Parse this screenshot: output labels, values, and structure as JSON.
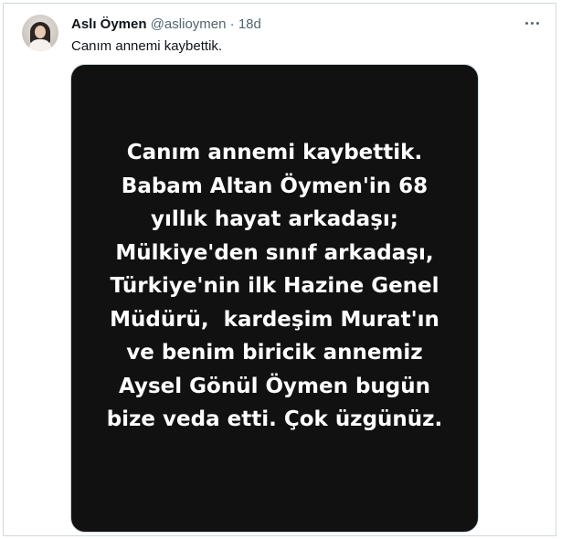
{
  "tweet": {
    "author_name": "Aslı Öymen",
    "author_handle": "@aslioymen",
    "separator": "·",
    "timestamp": "18d",
    "text": "Canım annemi kaybettik.",
    "more_icon": "more-horizontal-icon"
  },
  "media": {
    "lines": [
      "Canım annemi kaybettik.",
      "Babam Altan Öymen'in 68",
      "yıllık hayat arkadaşı;",
      "Mülkiye'den sınıf arkadaşı,",
      "Türkiye'nin ilk Hazine Genel",
      "Müdürü,  kardeşim Murat'ın",
      "ve benim biricik annemiz",
      "Aysel Gönül Öymen bugün",
      "bize veda etti. Çok üzgünüz."
    ],
    "background_color": "#111111",
    "text_color": "#ffffff"
  }
}
